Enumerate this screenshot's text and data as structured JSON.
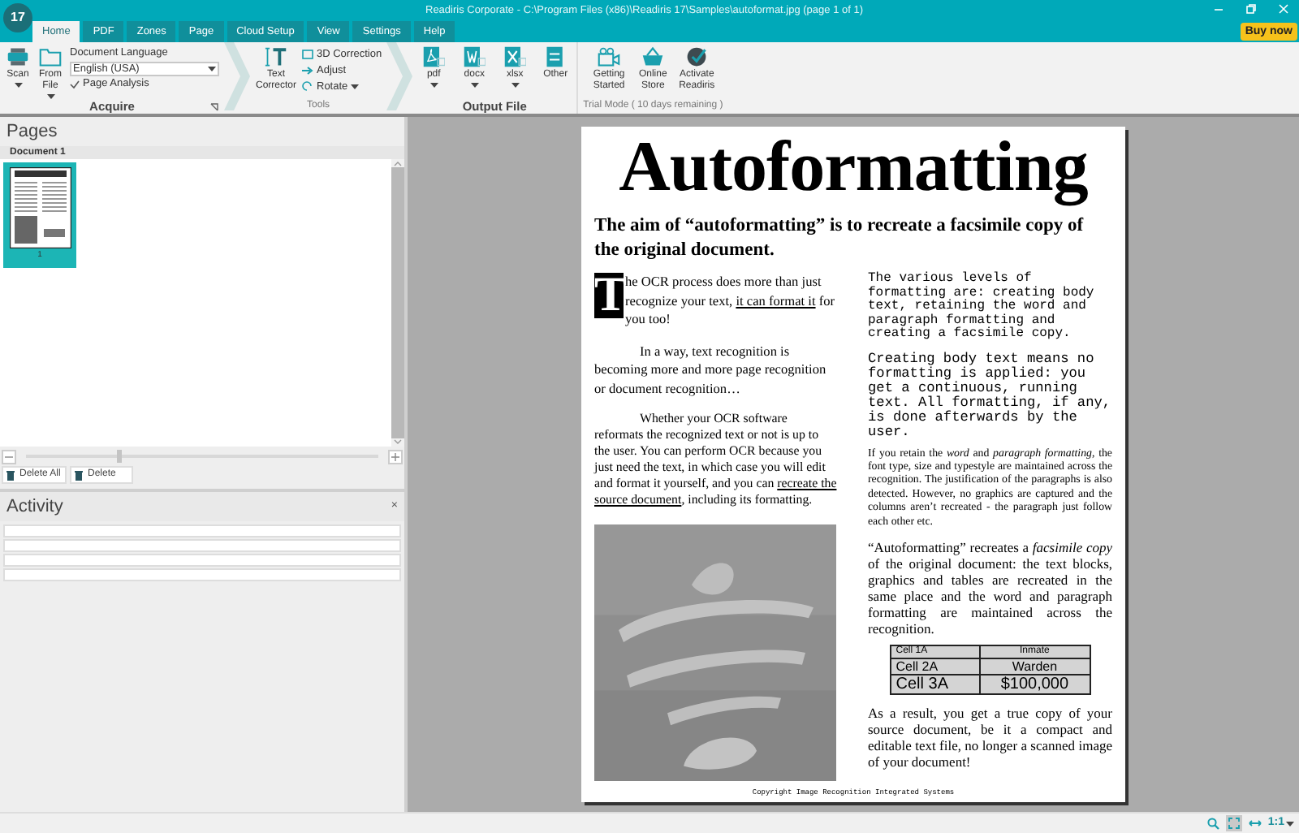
{
  "window": {
    "title": "Readiris Corporate - C:\\Program Files (x86)\\Readiris 17\\Samples\\autoformat.jpg (page 1 of 1)",
    "app_badge": "17"
  },
  "buy_button": "Buy now",
  "tabs": [
    {
      "label": "Home",
      "selected": true
    },
    {
      "label": "PDF",
      "selected": false
    },
    {
      "label": "Zones",
      "selected": false
    },
    {
      "label": "Page",
      "selected": false
    },
    {
      "label": "Cloud Setup",
      "selected": false
    },
    {
      "label": "View",
      "selected": false
    },
    {
      "label": "Settings",
      "selected": false
    },
    {
      "label": "Help",
      "selected": false
    }
  ],
  "ribbon_groups": [
    {
      "kind": "acquire",
      "label": "Acquire",
      "buttons": [
        {
          "label": "Scan",
          "dropdown": true
        },
        {
          "label": "From File",
          "dropdown": true
        }
      ],
      "language_label": "Document Language",
      "language": "English (USA)",
      "page_analysis": {
        "label": "Page Analysis",
        "checked": true
      }
    },
    {
      "kind": "tools",
      "label": "Tools",
      "buttons": [
        {
          "label": "Text Corrector",
          "dropdown": false
        }
      ],
      "small_buttons": [
        {
          "label": "3D Correction",
          "dropdown": false
        },
        {
          "label": "Adjust",
          "dropdown": false
        },
        {
          "label": "Rotate",
          "dropdown": true
        }
      ]
    },
    {
      "kind": "output",
      "label": "Output File",
      "buttons": [
        {
          "label": "pdf",
          "dropdown": true
        },
        {
          "label": "docx",
          "dropdown": true
        },
        {
          "label": "xlsx",
          "dropdown": true
        },
        {
          "label": "Other",
          "dropdown": false
        }
      ]
    },
    {
      "kind": "trial",
      "label": "Trial Mode ( 10 days remaining )",
      "buttons": [
        {
          "label": "Getting Started",
          "dropdown": false
        },
        {
          "label": "Online Store",
          "dropdown": false
        },
        {
          "label": "Activate Readiris",
          "dropdown": false
        }
      ]
    }
  ],
  "pages_panel": {
    "title": "Pages",
    "document": "Document 1",
    "zoom_slider": {
      "level": 0.26
    },
    "thumbnails": [
      {
        "page": "1",
        "selected": true
      }
    ],
    "buttons": [
      "Delete All",
      "Delete"
    ]
  },
  "activity_panel": {
    "title": "Activity",
    "close": "×"
  },
  "document": {
    "title": "Autoformatting",
    "subtitle": "The aim of “autoformatting” is to recreate a facsimile copy of the original document.",
    "left_column": [
      {
        "kind": "dropcap",
        "drop_cap": "T",
        "segments": [
          {
            "text": "he OCR process does more than just recognize your text, ",
            "underline": false
          },
          {
            "text": "it can format it",
            "underline": true
          },
          {
            "text": " for you too!",
            "underline": false
          }
        ]
      },
      {
        "kind": "indented",
        "segments": [
          {
            "text": "In a way, text recognition is becoming more and more page recognition or document recognition…",
            "underline": false
          }
        ]
      },
      {
        "kind": "indented_small",
        "segments": [
          {
            "text": "Whether your OCR software reformats the recognized text or not is up to the user. You can perform OCR because you just need the text, in which case you will edit and format it yourself, and you can ",
            "underline": false
          },
          {
            "text": "recreate the source document",
            "underline": true
          },
          {
            "text": ", including its formatting.",
            "underline": false
          }
        ]
      },
      {
        "kind": "picture"
      }
    ],
    "right_column": [
      {
        "kind": "mono",
        "text": "The various levels of formatting are: creating body text, retaining the word and paragraph formatting and creating a facsimile copy."
      },
      {
        "kind": "mono_large",
        "text": "Creating body text means no formatting is applied: you get a continuous, running text. All formatting, if any, is done afterwards by the user."
      },
      {
        "kind": "small",
        "text": "If you retain the *word* and *paragraph formatting*, the font type, size and typestyle are maintained across the recognition. The justification of the paragraphs is also detected. However, no graphics are captured and the columns aren’t recreated - the paragraph just follow each other etc."
      },
      {
        "kind": "justified",
        "text": "“Autoformatting” recreates a *facsimile copy* of the original document: the text blocks, graphics and tables are recreated in the same place and the word and paragraph formatting are maintained across the recognition."
      },
      {
        "kind": "table",
        "rows": [
          [
            "Cell 1A",
            "Inmate"
          ],
          [
            "Cell 2A",
            "Warden"
          ],
          [
            "Cell 3A",
            "$100,000"
          ]
        ]
      },
      {
        "kind": "justified",
        "text": "As a result, you get a true copy of your source document, be it a compact and editable text file, no longer a scanned image of your document!"
      }
    ],
    "footer": "Copyright Image Recognition Integrated Systems"
  },
  "status_bar": {
    "view_buttons": [
      {
        "kind": "zoom",
        "selected": false
      },
      {
        "kind": "fit_page",
        "selected": true
      },
      {
        "kind": "fit_width",
        "selected": false
      }
    ],
    "zoom": "1:1"
  }
}
